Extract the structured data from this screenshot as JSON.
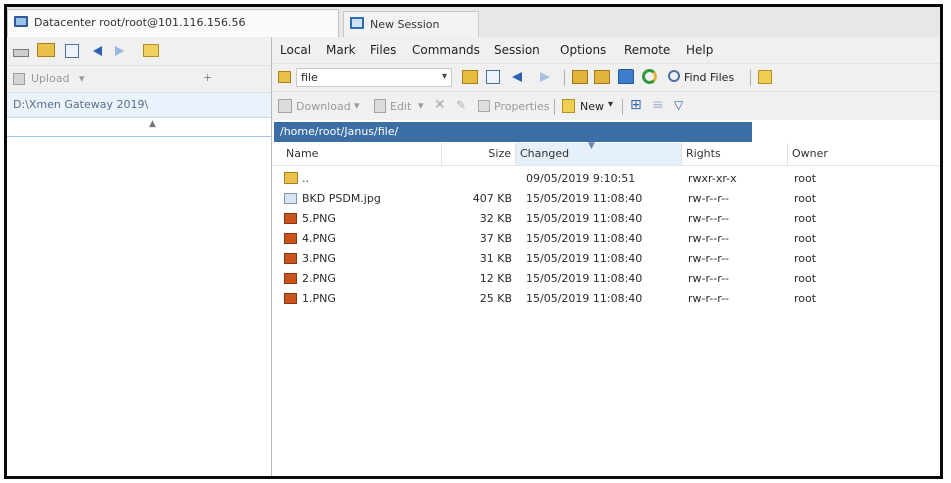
{
  "tabs": [
    {
      "label": "Datacenter root/root@101.116.156.56"
    },
    {
      "label": "New Session"
    }
  ],
  "menu": [
    "Local",
    "Mark",
    "Files",
    "Commands",
    "Session",
    "Options",
    "Remote",
    "Help"
  ],
  "left": {
    "upload_label": "Upload",
    "path": "D:\\Xmen Gateway 2019\\"
  },
  "right": {
    "folder_select": "file",
    "find_files_label": "Find Files",
    "download_label": "Download",
    "edit_label": "Edit",
    "properties_label": "Properties",
    "new_label": "New",
    "path": "/home/root/Janus/file/"
  },
  "columns": [
    "Name",
    "Size",
    "Changed",
    "Rights",
    "Owner"
  ],
  "files": [
    {
      "name": "..",
      "size": "",
      "changed": "09/05/2019 9:10:51",
      "rights": "rwxr-xr-x",
      "owner": "root"
    },
    {
      "name": "BKD PSDM.jpg",
      "size": "407 KB",
      "changed": "15/05/2019 11:08:40",
      "rights": "rw-r--r--",
      "owner": "root"
    },
    {
      "name": "5.PNG",
      "size": "32 KB",
      "changed": "15/05/2019 11:08:40",
      "rights": "rw-r--r--",
      "owner": "root"
    },
    {
      "name": "4.PNG",
      "size": "37 KB",
      "changed": "15/05/2019 11:08:40",
      "rights": "rw-r--r--",
      "owner": "root"
    },
    {
      "name": "3.PNG",
      "size": "31 KB",
      "changed": "15/05/2019 11:08:40",
      "rights": "rw-r--r--",
      "owner": "root"
    },
    {
      "name": "2.PNG",
      "size": "12 KB",
      "changed": "15/05/2019 11:08:40",
      "rights": "rw-r--r--",
      "owner": "root"
    },
    {
      "name": "1.PNG",
      "size": "25 KB",
      "changed": "15/05/2019 11:08:40",
      "rights": "rw-r--r--",
      "owner": "root"
    }
  ]
}
